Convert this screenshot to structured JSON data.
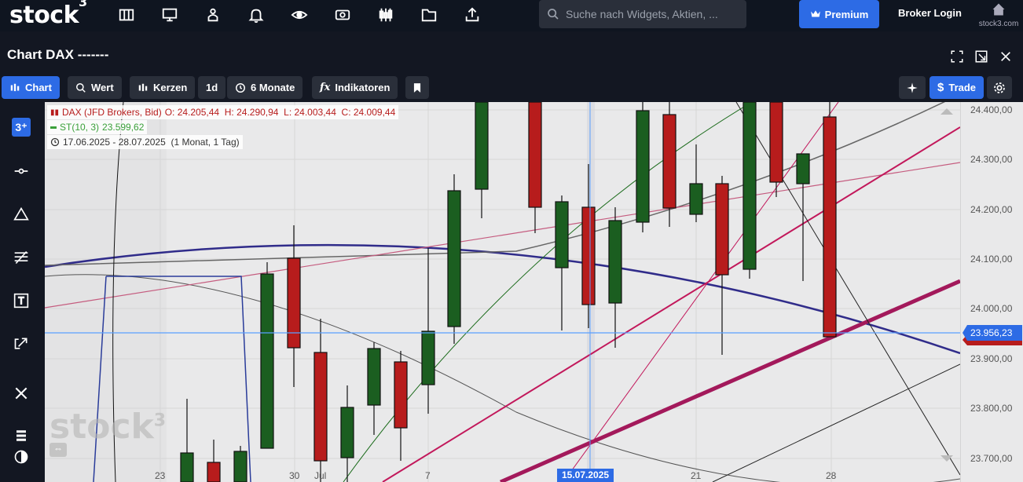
{
  "logo": {
    "text": "stock",
    "sup": "3"
  },
  "search": {
    "placeholder": "Suche nach Widgets, Aktien, ..."
  },
  "header": {
    "premium_label": "Premium",
    "broker_label": "Broker Login",
    "brand_site": "stock3.com"
  },
  "chart_title": "Chart DAX -------",
  "toolbar": {
    "chart": "Chart",
    "value": "Wert",
    "candles": "Kerzen",
    "interval": "1d",
    "range": "6 Monate",
    "indicators": "Indikatoren",
    "trade": "Trade"
  },
  "legend": {
    "instrument": "DAX (JFD Brokers, Bid)",
    "ohlc": "O: 24.205,44  H: 24.290,94  L: 24.003,44  C: 24.009,44",
    "indicator": "ST(10, 3)",
    "indicator_value": "23.599,62",
    "period": "17.06.2025 - 28.07.2025  (1 Monat, 1 Tag)"
  },
  "price_axis": [
    "24.400,00",
    "24.300,00",
    "24.200,00",
    "24.100,00",
    "24.000,00",
    "23.900,00",
    "23.800,00",
    "23.700,00"
  ],
  "current_price": "23.956,23",
  "x_axis": [
    "23",
    "30",
    "Jul",
    "7",
    "21",
    "28"
  ],
  "crosshair_date": "15.07.2025",
  "watermark": "stock",
  "colors": {
    "accent": "#2d6be5",
    "up": "#1b5e20",
    "down": "#b71c1c",
    "crosshair": "#5aa0ff"
  }
}
